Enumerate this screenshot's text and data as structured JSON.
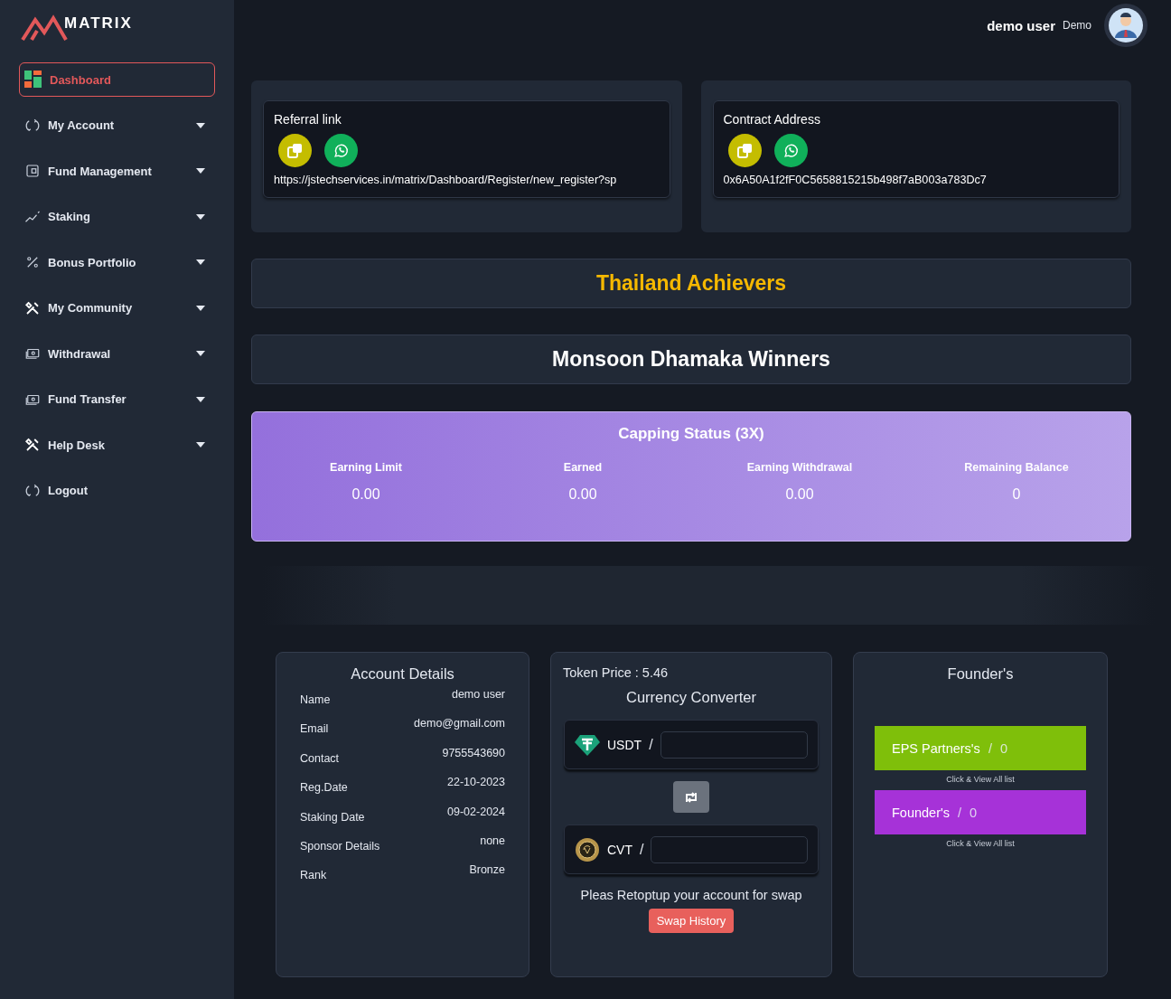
{
  "brand": {
    "name": "MATRIX"
  },
  "sidebar": {
    "items": [
      {
        "label": "Dashboard",
        "selected": true,
        "kind": "link"
      },
      {
        "label": "My Account",
        "selected": false,
        "kind": "dropdown"
      },
      {
        "label": "Fund Management",
        "selected": false,
        "kind": "dropdown"
      },
      {
        "label": "Staking",
        "selected": false,
        "kind": "dropdown"
      },
      {
        "label": "Bonus Portfolio",
        "selected": false,
        "kind": "dropdown"
      },
      {
        "label": "My Community",
        "selected": false,
        "kind": "dropdown"
      },
      {
        "label": "Withdrawal",
        "selected": false,
        "kind": "dropdown"
      },
      {
        "label": "Fund Transfer",
        "selected": false,
        "kind": "dropdown"
      },
      {
        "label": "Help Desk",
        "selected": false,
        "kind": "dropdown"
      },
      {
        "label": "Logout",
        "selected": false,
        "kind": "link"
      }
    ]
  },
  "header": {
    "user_name": "demo user",
    "user_role": "Demo"
  },
  "link_cards": [
    {
      "title": "Referral link",
      "value": "https://jstechservices.in/matrix/Dashboard/Register/new_register?sp"
    },
    {
      "title": "Contract Address",
      "value": "0x6A50A1f2fF0C5658815215b498f7aB003a783Dc7"
    }
  ],
  "banners": [
    {
      "title": "Thailand Achievers",
      "color": "#f5b800"
    },
    {
      "title": "Monsoon Dhamaka Winners",
      "color": "#ffffff"
    }
  ],
  "capping_status": {
    "title": "Capping Status (3X)",
    "stats": [
      {
        "label": "Earning Limit",
        "value": "0.00"
      },
      {
        "label": "Earned",
        "value": "0.00"
      },
      {
        "label": "Earning Withdrawal",
        "value": "0.00"
      },
      {
        "label": "Remaining Balance",
        "value": "0"
      }
    ]
  },
  "account_details": {
    "title": "Account Details",
    "rows": [
      {
        "label": "Name",
        "value": "demo user"
      },
      {
        "label": "Email",
        "value": "demo@gmail.com"
      },
      {
        "label": "Contact",
        "value": "9755543690"
      },
      {
        "label": "Reg.Date",
        "value": "22-10-2023"
      },
      {
        "label": "Staking Date",
        "value": "09-02-2024"
      },
      {
        "label": "Sponsor Details",
        "value": "none"
      },
      {
        "label": "Rank",
        "value": "Bronze"
      }
    ]
  },
  "converter": {
    "token_price": "Token Price : 5.46",
    "title": "Currency Converter",
    "currencies": [
      {
        "code": "USDT",
        "separator": "/",
        "kind": "usdt"
      },
      {
        "code": "CVT",
        "separator": "/",
        "kind": "cvt"
      }
    ],
    "notice": "Pleas Retoptup your account for swap",
    "history_button": "Swap History"
  },
  "founders": {
    "title": "Founder's",
    "groups": [
      {
        "label": "EPS Partners's",
        "separator": "/",
        "count": "0",
        "link": "Click & View All list",
        "color": "#7fbf0a"
      },
      {
        "label": "Founder's",
        "separator": "/",
        "count": "0",
        "link": "Click & View All list",
        "color": "#a632d8"
      }
    ]
  }
}
